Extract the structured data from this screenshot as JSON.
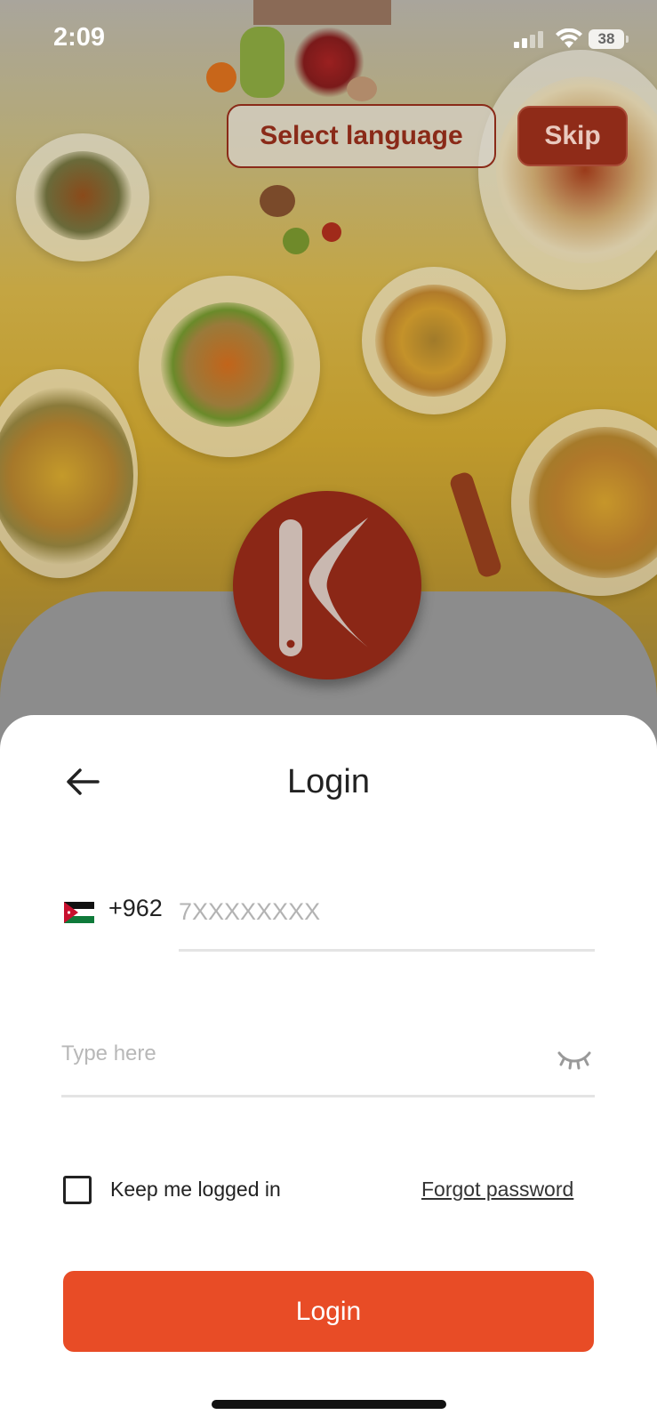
{
  "status_bar": {
    "time": "2:09",
    "battery": "38"
  },
  "top_actions": {
    "select_language": "Select language",
    "skip": "Skip"
  },
  "login": {
    "title": "Login",
    "country_code": "+962",
    "phone_placeholder": "7XXXXXXXX",
    "password_placeholder": "Type here",
    "keep_logged_in": "Keep me logged in",
    "forgot_password": "Forgot password",
    "submit_label": "Login"
  },
  "colors": {
    "accent": "#e84c26",
    "brand_dark": "#8b2716"
  }
}
